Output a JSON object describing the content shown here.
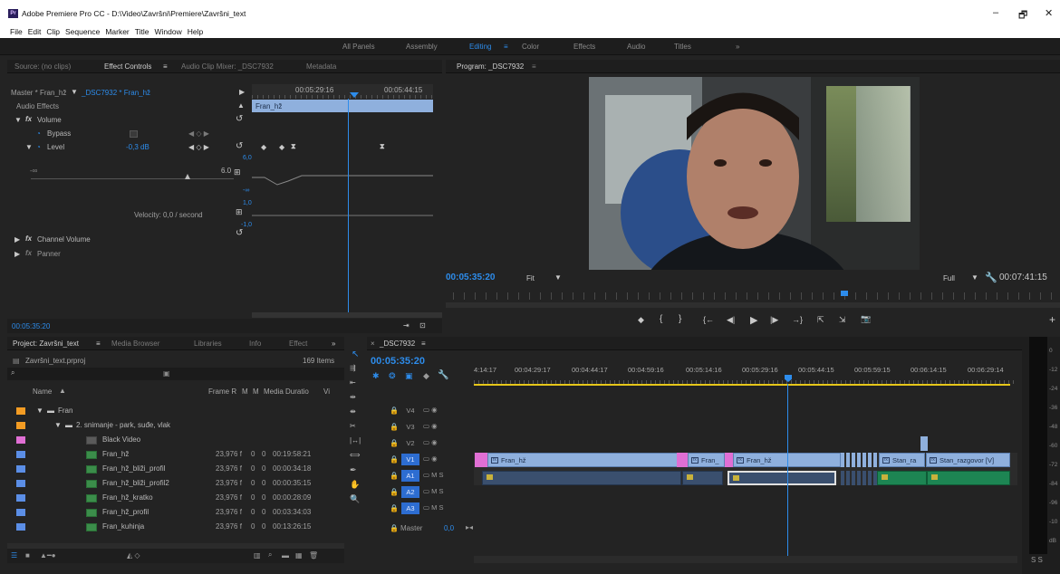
{
  "titlebar": {
    "app_icon": "Pr",
    "title": "Adobe Premiere Pro CC - D:\\Video\\Završni\\Premiere\\Završni_text",
    "controls": [
      "–",
      "🗗",
      "✕"
    ]
  },
  "menu": [
    "File",
    "Edit",
    "Clip",
    "Sequence",
    "Marker",
    "Title",
    "Window",
    "Help"
  ],
  "workspaces": {
    "items": [
      "All Panels",
      "Assembly",
      "Editing",
      "Color",
      "Effects",
      "Audio",
      "Titles",
      "»"
    ],
    "active_menu_icon": "≡"
  },
  "source_panel": {
    "tabs": [
      "Source: (no clips)",
      "Effect Controls",
      "Audio Clip Mixer: _DSC7932",
      "Metadata"
    ],
    "tab_menu": "≡",
    "master_label": "Master * Fran_hž",
    "clip_label": "_DSC7932 * Fran_hž",
    "ruler_time_1": "00:05:29:16",
    "ruler_time_2": "00:05:44:15",
    "clip_bar_label": "Fran_hž",
    "audio_effects_label": "Audio Effects",
    "volume_label": "Volume",
    "bypass_label": "Bypass",
    "level_label": "Level",
    "level_value": "-0,3 dB",
    "minus_inf": "-∞",
    "slider_max": "6.0",
    "graph_top": "6,0",
    "graph_neg_inf": "-∞",
    "graph_mid_top": "1,0",
    "graph_mid_bot": "-1,0",
    "velocity_label": "Velocity: 0,0 / second",
    "channel_volume_label": "Channel Volume",
    "panner_label": "Panner",
    "timecode": "00:05:35:20"
  },
  "program_panel": {
    "title": "Program: _DSC7932",
    "menu_icon": "≡",
    "timecode": "00:05:35:20",
    "fit_label": "Fit",
    "full_label": "Full",
    "duration": "00:07:41:15",
    "transport": [
      "◆",
      "{",
      "}",
      "{←",
      "◀|",
      "▶",
      "|▶",
      "→}",
      "⇱",
      "⇲",
      "📷"
    ],
    "add_button": "+"
  },
  "project_panel": {
    "tabs": [
      "Project: Završni_text",
      "Media Browser",
      "Libraries",
      "Info",
      "Effect",
      "»"
    ],
    "tab_menu": "≡",
    "file_name": "Završni_text.prproj",
    "item_count": "169 Items",
    "col_name": "Name",
    "col_frame": "Frame R",
    "col_m1": "M",
    "col_m2": "M",
    "col_duration": "Media Duratio",
    "col_vi": "Vi",
    "rows": [
      {
        "name": "Fran",
        "type": "folder",
        "swatch": "#f39c23",
        "frame": "",
        "z1": "",
        "z2": "",
        "dur": "",
        "indent": 1
      },
      {
        "name": "2. snimanje - park, suđe, vlak",
        "type": "folder",
        "swatch": "#f39c23",
        "frame": "",
        "z1": "",
        "z2": "",
        "dur": "",
        "indent": 2
      },
      {
        "name": "Black Video",
        "type": "black",
        "swatch": "#e06fd4",
        "frame": "",
        "z1": "",
        "z2": "",
        "dur": "",
        "indent": 3
      },
      {
        "name": "Fran_hž",
        "type": "clip",
        "swatch": "#5b8ee6",
        "frame": "23,976 f",
        "z1": "0",
        "z2": "0",
        "dur": "00:19:58:21",
        "indent": 3
      },
      {
        "name": "Fran_hž_bliži_profil",
        "type": "clip",
        "swatch": "#5b8ee6",
        "frame": "23,976 f",
        "z1": "0",
        "z2": "0",
        "dur": "00:00:34:18",
        "indent": 3
      },
      {
        "name": "Fran_hž_bliži_profil2",
        "type": "clip",
        "swatch": "#5b8ee6",
        "frame": "23,976 f",
        "z1": "0",
        "z2": "0",
        "dur": "00:00:35:15",
        "indent": 3
      },
      {
        "name": "Fran_hž_kratko",
        "type": "clip",
        "swatch": "#5b8ee6",
        "frame": "23,976 f",
        "z1": "0",
        "z2": "0",
        "dur": "00:00:28:09",
        "indent": 3
      },
      {
        "name": "Fran_hž_profil",
        "type": "clip",
        "swatch": "#5b8ee6",
        "frame": "23,976 f",
        "z1": "0",
        "z2": "0",
        "dur": "00:03:34:03",
        "indent": 3
      },
      {
        "name": "Fran_kuhinja",
        "type": "clip",
        "swatch": "#5b8ee6",
        "frame": "23,976 f",
        "z1": "0",
        "z2": "0",
        "dur": "00:13:26:15",
        "indent": 3
      }
    ]
  },
  "timeline_panel": {
    "tab": "_DSC7932",
    "close": "×",
    "menu_icon": "≡",
    "timecode": "00:05:35:20",
    "ruler": [
      "4:14:17",
      "00:04:29:17",
      "00:04:44:17",
      "00:04:59:16",
      "00:05:14:16",
      "00:05:29:16",
      "00:05:44:15",
      "00:05:59:15",
      "00:06:14:15",
      "00:06:29:14"
    ],
    "video_tracks": [
      "V4",
      "V3",
      "V2",
      "V1"
    ],
    "audio_tracks": [
      "A1",
      "A2",
      "A3"
    ],
    "master_label": "Master",
    "master_value": "0,0",
    "video_clips": [
      "Fran_hž",
      "Fran_",
      "Fran_hž",
      "Stan_ra",
      "Stan_razgovor [V]"
    ],
    "audio_clip_icon": "fx"
  },
  "audio_meter": {
    "labels": [
      "0",
      "-12",
      "-24",
      "-36",
      "-48",
      "-60",
      "-72",
      "-84",
      "-96",
      "-10",
      "dB"
    ],
    "bottom": "S S"
  },
  "colors": {
    "accent": "#2d8ceb",
    "video_clip": "#8fb0dd",
    "audio_clip": "#1d8553",
    "label_orange": "#f39c23",
    "label_pink": "#e06fd4",
    "playhead": "#2d8ceb"
  }
}
